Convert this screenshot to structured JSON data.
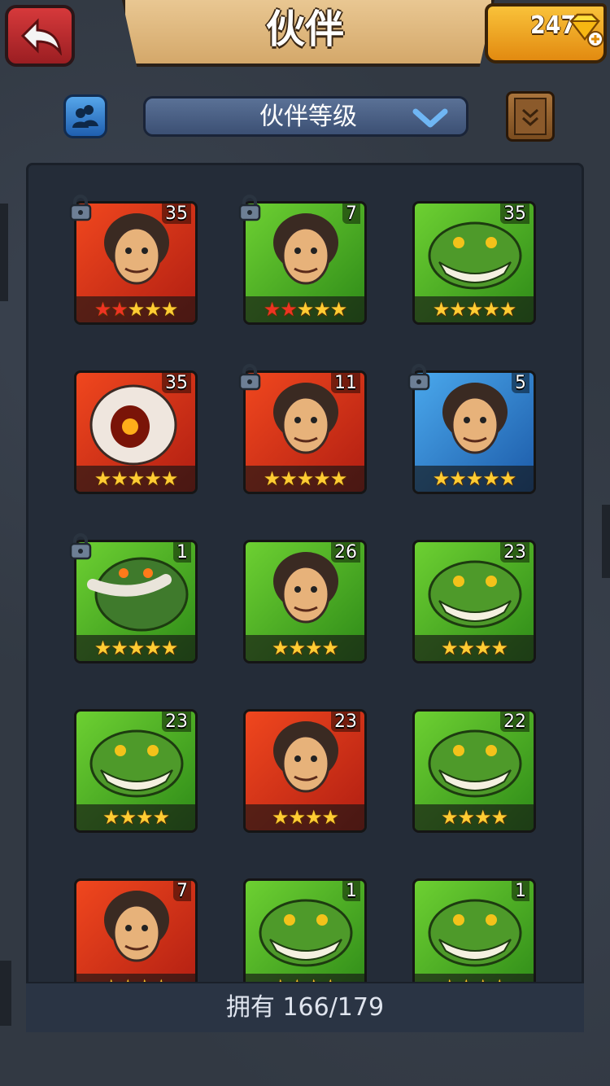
{
  "header": {
    "title": "伙伴",
    "gems": "247"
  },
  "filter": {
    "dropdown_label": "伙伴等级"
  },
  "footer": {
    "owned_text": "拥有 166/179"
  },
  "colors": {
    "red_card": "#e2361c",
    "green_card": "#45a623",
    "blue_card": "#2f8fd6",
    "stars": "#ffcc33"
  },
  "heroes": [
    {
      "level": "35",
      "bg": "red",
      "locked": true,
      "stars": 5,
      "red_stars": 2,
      "portrait": "bearded-warrior"
    },
    {
      "level": "7",
      "bg": "green",
      "locked": true,
      "stars": 5,
      "red_stars": 2,
      "portrait": "bearded-warrior-dark"
    },
    {
      "level": "35",
      "bg": "green",
      "locked": false,
      "stars": 5,
      "red_stars": 0,
      "portrait": "shark"
    },
    {
      "level": "35",
      "bg": "red",
      "locked": false,
      "stars": 5,
      "red_stars": 0,
      "portrait": "skull-creature"
    },
    {
      "level": "11",
      "bg": "red",
      "locked": true,
      "stars": 5,
      "red_stars": 0,
      "portrait": "hooded-woman"
    },
    {
      "level": "5",
      "bg": "blue",
      "locked": true,
      "stars": 5,
      "red_stars": 0,
      "portrait": "pirate-brute"
    },
    {
      "level": "1",
      "bg": "green",
      "locked": true,
      "stars": 5,
      "red_stars": 0,
      "portrait": "mammoth"
    },
    {
      "level": "26",
      "bg": "green",
      "locked": false,
      "stars": 4,
      "red_stars": 0,
      "portrait": "elf-girl"
    },
    {
      "level": "23",
      "bg": "green",
      "locked": false,
      "stars": 4,
      "red_stars": 0,
      "portrait": "crocodile"
    },
    {
      "level": "23",
      "bg": "green",
      "locked": false,
      "stars": 4,
      "red_stars": 0,
      "portrait": "crocodile"
    },
    {
      "level": "23",
      "bg": "red",
      "locked": false,
      "stars": 4,
      "red_stars": 0,
      "portrait": "red-haired-girl"
    },
    {
      "level": "22",
      "bg": "green",
      "locked": false,
      "stars": 4,
      "red_stars": 0,
      "portrait": "crocodile"
    },
    {
      "level": "7",
      "bg": "red",
      "locked": false,
      "stars": 4,
      "red_stars": 0,
      "portrait": "red-sorceress"
    },
    {
      "level": "1",
      "bg": "green",
      "locked": false,
      "stars": 4,
      "red_stars": 0,
      "portrait": "green-beast"
    },
    {
      "level": "1",
      "bg": "green",
      "locked": false,
      "stars": 4,
      "red_stars": 0,
      "portrait": "green-beast"
    }
  ]
}
